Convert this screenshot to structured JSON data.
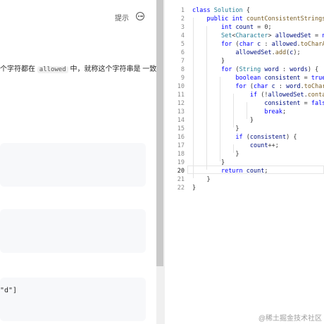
{
  "problem": {
    "hint_label": "提示",
    "more_icon": "ellipsis-circle-icon",
    "description_before": "个字符都在",
    "inline_code": "allowed",
    "description_after": "中，就称这个字符串是",
    "description_end": "一致",
    "example3_text": "\"d\"]"
  },
  "editor": {
    "lines": [
      {
        "n": "1",
        "html": "<span class=\"kw\">class</span> <span class=\"ty\">Solution</span> {"
      },
      {
        "n": "2",
        "html": "    <span class=\"kw\">public</span> <span class=\"kw\">int</span> <span class=\"fn\">countConsistentStrings</span>(<span class=\"ty\">St</span>"
      },
      {
        "n": "3",
        "html": "        <span class=\"kw\">int</span> <span class=\"vr\">count</span> = 0;"
      },
      {
        "n": "4",
        "html": "        <span class=\"ty\">Set</span>&lt;<span class=\"ty\">Character</span>&gt; <span class=\"vr\">allowedSet</span> = <span class=\"kw\">new</span>"
      },
      {
        "n": "5",
        "html": "        <span class=\"kw\">for</span> (<span class=\"kw\">char</span> <span class=\"vr\">c</span> : <span class=\"vr\">allowed</span>.<span class=\"fn\">toCharArra</span>"
      },
      {
        "n": "6",
        "html": "            <span class=\"vr\">allowedSet</span>.<span class=\"fn\">add</span>(<span class=\"vr\">c</span>);"
      },
      {
        "n": "7",
        "html": "        }"
      },
      {
        "n": "8",
        "html": "        <span class=\"kw\">for</span> (<span class=\"ty\">String</span> <span class=\"vr\">word</span> : <span class=\"vr\">words</span>) {"
      },
      {
        "n": "9",
        "html": "            <span class=\"kw\">boolean</span> <span class=\"vr\">consistent</span> = <span class=\"kw\">true</span>;"
      },
      {
        "n": "10",
        "html": "            <span class=\"kw\">for</span> (<span class=\"kw\">char</span> <span class=\"vr\">c</span> : <span class=\"vr\">word</span>.<span class=\"fn\">toCharArra</span>"
      },
      {
        "n": "11",
        "html": "                <span class=\"kw\">if</span> (!<span class=\"vr\">allowedSet</span>.<span class=\"fn\">contains</span>"
      },
      {
        "n": "12",
        "html": "                    <span class=\"vr\">consistent</span> = <span class=\"kw\">false</span>;"
      },
      {
        "n": "13",
        "html": "                    <span class=\"kw\">break</span>;"
      },
      {
        "n": "14",
        "html": "                }"
      },
      {
        "n": "15",
        "html": "            }"
      },
      {
        "n": "16",
        "html": "            <span class=\"kw\">if</span> (<span class=\"vr\">consistent</span>) {"
      },
      {
        "n": "17",
        "html": "                <span class=\"vr\">count</span>++;"
      },
      {
        "n": "18",
        "html": "            }"
      },
      {
        "n": "19",
        "html": "        }"
      },
      {
        "n": "20",
        "html": "        <span class=\"kw\">return</span> <span class=\"vr\">count</span>;"
      },
      {
        "n": "21",
        "html": "    }"
      },
      {
        "n": "22",
        "html": "}"
      }
    ],
    "active_line": "20"
  },
  "watermark": "@稀土掘金技术社区"
}
